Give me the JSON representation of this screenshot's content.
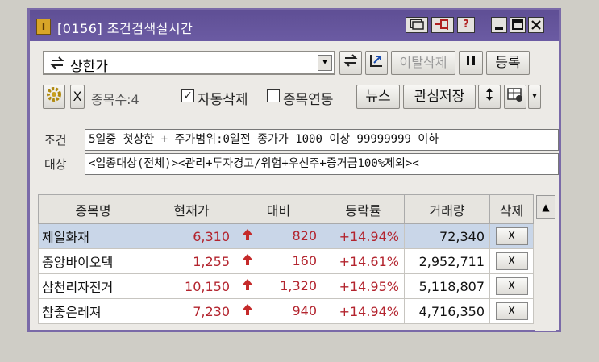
{
  "window": {
    "title": "[0156] 조건검색실시간",
    "app_icon": "I",
    "buttons": {
      "help": "?"
    }
  },
  "toolbar": {
    "condition_select": "상한가",
    "realtime_remove_label": "이탈삭제",
    "register_label": "등록",
    "x_label": "X",
    "count_label": "종목수:4",
    "auto_delete_label": "자동삭제",
    "auto_delete_checked": true,
    "stock_link_label": "종목연동",
    "stock_link_checked": false,
    "news_label": "뉴스",
    "save_interest_label": "관심저장"
  },
  "condition": {
    "cond_label": "조건",
    "cond_text": "5일중 첫상한 + 주가범위:0일전 종가가 1000 이상 99999999 이하",
    "target_label": "대상",
    "target_text": "<업종대상(전체)><관리+투자경고/위험+우선주+증거금100%제외><"
  },
  "table": {
    "headers": [
      "종목명",
      "현재가",
      "대비",
      "등락률",
      "거래량",
      "삭제"
    ],
    "rows": [
      {
        "name": "제일화재",
        "price": "6,310",
        "change": "820",
        "rate": "+14.94%",
        "volume": "72,340",
        "delete": "X"
      },
      {
        "name": "중앙바이오텍",
        "price": "1,255",
        "change": "160",
        "rate": "+14.61%",
        "volume": "2,952,711",
        "delete": "X"
      },
      {
        "name": "삼천리자전거",
        "price": "10,150",
        "change": "1,320",
        "rate": "+14.95%",
        "volume": "5,118,807",
        "delete": "X"
      },
      {
        "name": "참좋은레져",
        "price": "7,230",
        "change": "940",
        "rate": "+14.94%",
        "volume": "4,716,350",
        "delete": "X"
      }
    ]
  },
  "icons": {
    "swap": "swap-arrows-icon",
    "gear": "gear-icon",
    "pause": "pause-icon",
    "sort": "up-down-icon",
    "up_arrow": "red-up-arrow-icon"
  },
  "colors": {
    "title_bar": "#6b5ba3",
    "rise": "#b3242e",
    "selected_row": "#c9d6e8"
  }
}
